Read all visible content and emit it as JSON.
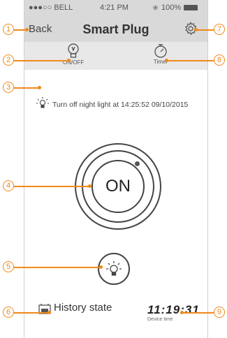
{
  "status_bar": {
    "carrier": "●●●○○ BELL",
    "time": "4:21 PM",
    "battery": "100%"
  },
  "nav": {
    "back_label": "Back",
    "title": "Smart Plug"
  },
  "toolbar": {
    "onoff_label": "ON/OFF",
    "timer_label": "Timer"
  },
  "night_light": {
    "text": "Turn off night light at 14:25:52 09/10/2015"
  },
  "power_button": {
    "label": "ON"
  },
  "history": {
    "label": "History state"
  },
  "device_time": {
    "value": "11:19:31",
    "label": "Device time"
  },
  "callouts": [
    "1",
    "2",
    "3",
    "4",
    "5",
    "6",
    "7",
    "8",
    "9"
  ],
  "colors": {
    "accent": "#f0891b",
    "bar": "#d9d9d9",
    "toolbar": "#e8e8e8"
  }
}
